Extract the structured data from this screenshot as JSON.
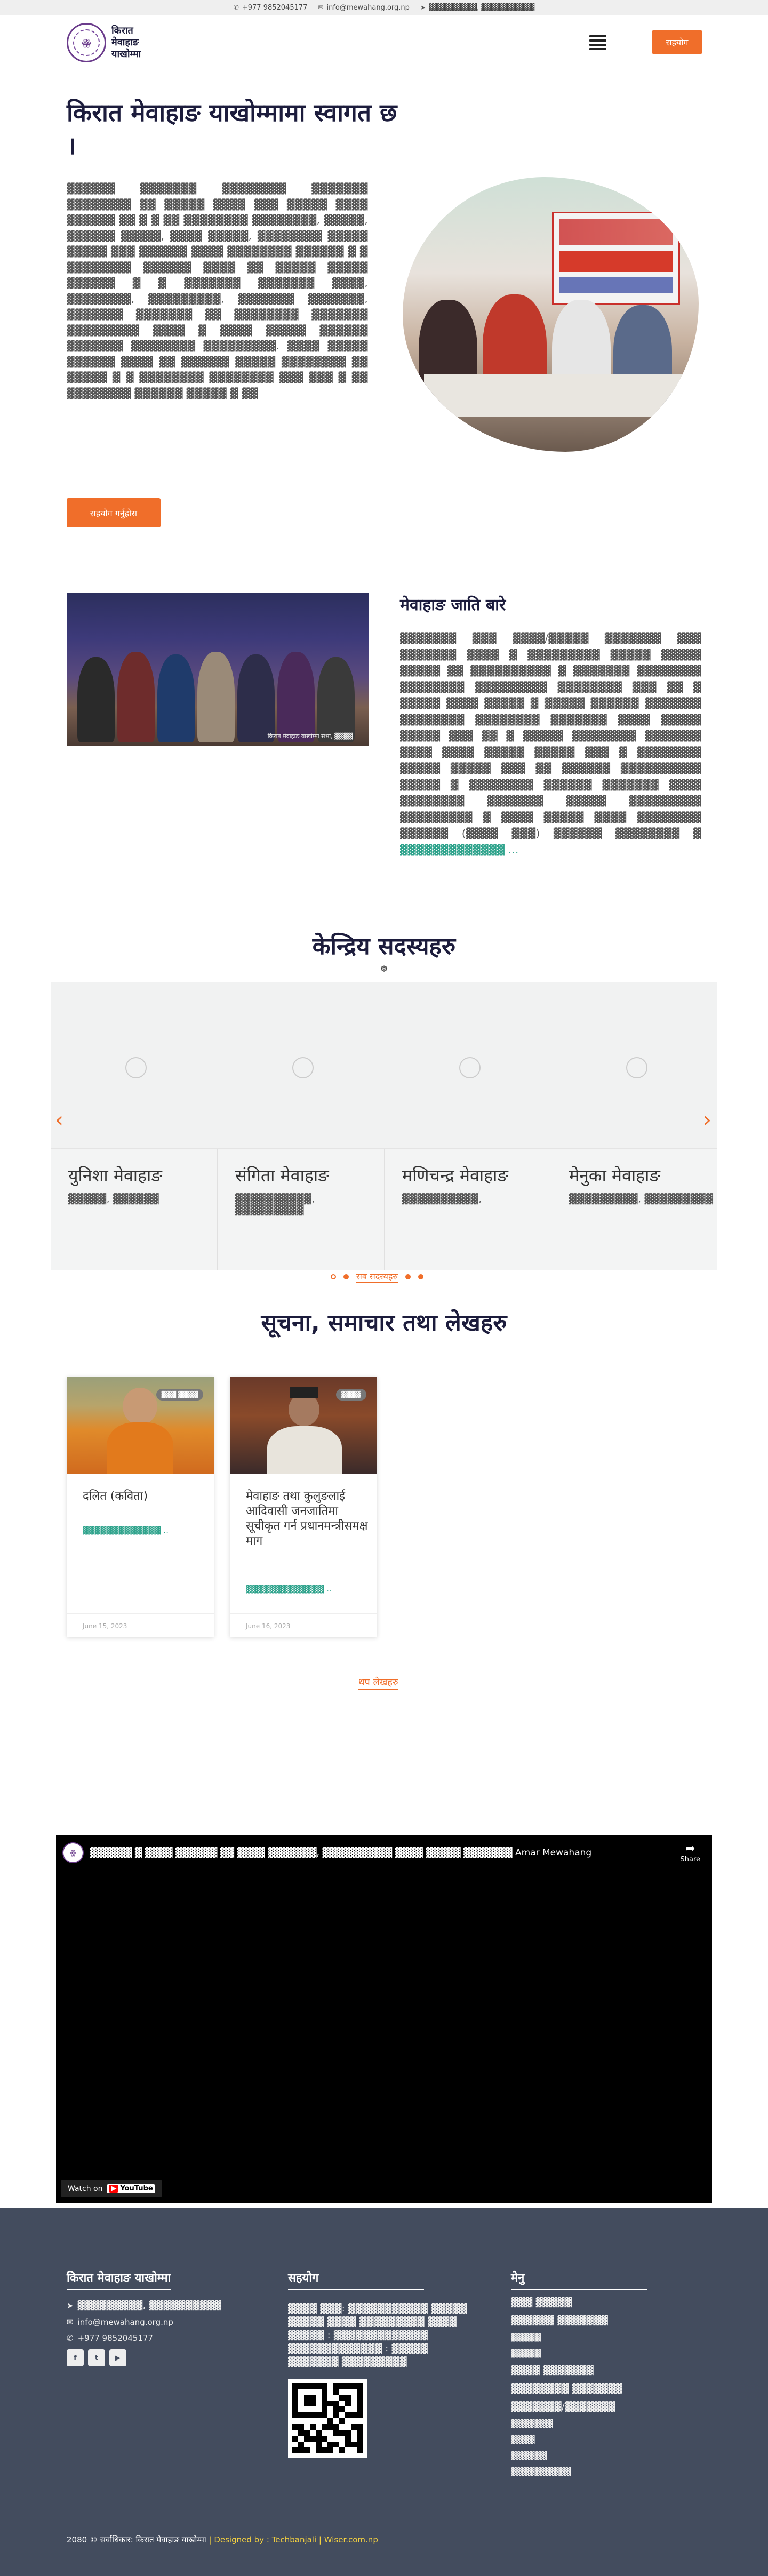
{
  "topbar": {
    "phone": "+977 9852045177",
    "email": "info@mewahang.org.np",
    "address": "▓▓▓▓▓▓▓▓▓, ▓▓▓▓▓▓▓▓▓▓"
  },
  "header": {
    "logo_text": "किरात\nमेवाहाङ\nयाखोम्मा",
    "logo_mark": "ꙮ",
    "support_button": "सहयोग"
  },
  "hero": {
    "title": "किरात मेवाहाङ याखोम्मामा स्वागत छ ।",
    "body": "▓▓▓▓▓▓ ▓▓▓▓▓▓▓ ▓▓▓▓▓▓▓▓ ▓▓▓▓▓▓▓ ▓▓▓▓▓▓▓▓ ▓▓ ▓▓▓▓▓ ▓▓▓▓ ▓▓▓ ▓▓▓▓▓ ▓▓▓▓ ▓▓▓▓▓▓ ▓▓ ▓ ▓ ▓▓ ▓▓▓▓▓▓▓▓ ▓▓▓▓▓▓▓▓, ▓▓▓▓▓, ▓▓▓▓▓▓ ▓▓▓▓▓, ▓▓▓▓ ▓▓▓▓▓, ▓▓▓▓▓▓▓▓ ▓▓▓▓▓ ▓▓▓▓▓ ▓▓▓ ▓▓▓▓▓▓ ▓▓▓▓ ▓▓▓▓▓▓▓▓ ▓▓▓▓▓▓ ▓ ▓ ▓▓▓▓▓▓▓▓ ▓▓▓▓▓▓ ▓▓▓▓ ▓▓ ▓▓▓▓▓ ▓▓▓▓▓ ▓▓▓▓▓▓ ▓ ▓ ▓▓▓▓▓▓▓ ▓▓▓▓▓▓▓ ▓▓▓▓, ▓▓▓▓▓▓▓▓, ▓▓▓▓▓▓▓▓▓, ▓▓▓▓▓▓▓ ▓▓▓▓▓▓▓, ▓▓▓▓▓▓▓ ▓▓▓▓▓▓▓ ▓▓ ▓▓▓▓▓▓▓▓ ▓▓▓▓▓▓▓ ▓▓▓▓▓▓▓▓▓ ▓▓▓▓ ▓ ▓▓▓▓ ▓▓▓▓▓ ▓▓▓▓▓▓ ▓▓▓▓▓▓▓ ▓▓▓▓▓▓▓▓ ▓▓▓▓▓▓▓▓▓. ▓▓▓▓ ▓▓▓▓▓ ▓▓▓▓▓▓ ▓▓▓▓ ▓▓ ▓▓▓▓▓▓ ▓▓▓▓▓ ▓▓▓▓▓▓▓▓ ▓▓ ▓▓▓▓▓ ▓ ▓ ▓▓▓▓▓▓▓▓ ▓▓▓▓▓▓▓▓ ▓▓▓ ▓▓▓ ▓ ▓▓ ▓▓▓▓▓▓▓▓ ▓▓▓▓▓▓ ▓▓▓▓▓ ▓ ▓▓",
    "button": "सहयोग गर्नुहोस"
  },
  "about": {
    "image_caption": "किरात मेवाहाङ याखोम्मा सभा, ▓▓▓▓",
    "title": "मेवाहाङ जाति बारे",
    "body": "▓▓▓▓▓▓▓ ▓▓▓ ▓▓▓▓/▓▓▓▓▓ ▓▓▓▓▓▓▓ ▓▓▓ ▓▓▓▓▓▓▓ ▓▓▓▓ ▓ ▓▓▓▓▓▓▓▓▓ ▓▓▓▓▓ ▓▓▓▓▓ ▓▓▓▓▓ ▓▓ ▓▓▓▓▓▓▓▓▓▓ ▓ ▓▓▓▓▓▓▓ ▓▓▓▓▓▓▓▓ ▓▓▓▓▓▓▓▓ ▓▓▓▓▓▓▓▓▓ ▓▓▓▓▓▓▓▓ ▓▓▓ ▓▓ ▓ ▓▓▓▓▓ ▓▓▓▓ ▓▓▓▓▓ ▓ ▓▓▓▓▓ ▓▓▓▓▓▓ ▓▓▓▓▓▓▓ ▓▓▓▓▓▓▓▓ ▓▓▓▓▓▓▓▓ ▓▓▓▓▓▓▓ ▓▓▓▓ ▓▓▓▓▓ ▓▓▓▓▓ ▓▓▓ ▓▓ ▓ ▓▓▓▓▓ ▓▓▓▓▓▓▓▓ ▓▓▓▓▓▓▓ ▓▓▓▓ ▓▓▓▓ ▓▓▓▓▓ ▓▓▓▓▓ ▓▓▓ ▓ ▓▓▓▓▓▓▓▓ ▓▓▓▓▓ ▓▓▓▓▓ ▓▓▓ ▓▓ ▓▓▓▓▓▓ ▓▓▓▓▓▓▓▓▓▓ ▓▓▓▓▓ ▓ ▓▓▓▓▓▓▓▓ ▓▓▓▓▓▓ ▓▓▓▓▓▓▓ ▓▓▓▓ ▓▓▓▓▓▓▓▓ ▓▓▓▓▓▓▓ ▓▓▓▓▓ ▓▓▓▓▓▓▓▓▓ ▓▓▓▓▓▓▓▓▓ ▓ ▓▓▓▓ ▓▓▓▓▓ ▓▓▓▓ ▓▓▓▓▓▓▓▓ ▓▓▓▓▓▓ (▓▓▓▓ ▓▓▓) ▓▓▓▓▓▓ ▓▓▓▓▓▓▓▓ ▓",
    "more_link": "▓▓▓▓▓▓▓▓▓▓▓▓▓ ..."
  },
  "members": {
    "title": "केन्द्रिय सदस्यहरु",
    "divider_icon": "☸",
    "prev": "‹",
    "next": "›",
    "cards": [
      {
        "name": "युनिशा मेवाहाङ",
        "role": "▓▓▓▓▓, ▓▓▓▓▓▓"
      },
      {
        "name": "संगिता मेवाहाङ",
        "role": "▓▓▓▓▓▓▓▓▓▓, ▓▓▓▓▓▓▓▓▓"
      },
      {
        "name": "मणिचन्द्र मेवाहाङ",
        "role": "▓▓▓▓▓▓▓▓▓▓,"
      },
      {
        "name": "मेनुका मेवाहाङ",
        "role": "▓▓▓▓▓▓▓▓▓, ▓▓▓▓▓▓▓▓▓"
      }
    ],
    "all_link": "सब सदस्यहरु"
  },
  "news": {
    "title": "सूचना, समाचार तथा लेखहरु",
    "posts": [
      {
        "tag": "▓▓▓ ▓▓▓▓",
        "title": "दलित (कविता)",
        "more": "▓▓▓▓▓▓▓▓▓▓▓▓▓ ..",
        "date": "June 15, 2023"
      },
      {
        "tag": "▓▓▓▓",
        "title": "मेवाहाङ तथा कुलुङलाई आदिवासी जनजातिमा सूचीकृत गर्न प्रधानमन्त्रीसमक्ष माग",
        "more": "▓▓▓▓▓▓▓▓▓▓▓▓▓ ..",
        "date": "June 16, 2023"
      }
    ],
    "more_posts": "थप लेखहरु"
  },
  "video": {
    "title": "▓▓▓▓▓▓ ▓ ▓▓▓▓ ▓▓▓▓▓▓ ▓▓ ▓▓▓▓ ▓▓▓▓▓▓▓, ▓▓▓▓▓▓▓▓▓▓ ▓▓▓▓ ▓▓▓▓▓ ▓▓▓▓▓▓▓ Amar Mewahang",
    "share": "Share",
    "watch_on": "Watch on",
    "youtube": "YouTube"
  },
  "footer": {
    "org_title": "किरात मेवाहाङ याखोम्मा",
    "address": "▓▓▓▓▓▓▓▓▓, ▓▓▓▓▓▓▓▓▓▓",
    "email": "info@mewahang.org.np",
    "phone": "+977 9852045177",
    "support_title": "सहयोग",
    "support_text": "▓▓▓▓ ▓▓▓: ▓▓▓▓▓▓▓▓▓▓▓ ▓▓▓▓▓ ▓▓▓▓▓ ▓▓▓▓ ▓▓▓▓▓▓▓▓▓ ▓▓▓▓ ▓▓▓▓▓ : ▓▓▓▓▓▓▓▓▓▓▓▓▓ ▓▓▓▓▓▓▓▓▓▓▓▓▓ : ▓▓▓▓▓ ▓▓▓▓▓▓▓ ▓▓▓▓▓▓▓▓▓",
    "menu_title": "मेनु",
    "menu": [
      {
        "label": "▓▓▓ ▓▓▓▓▓",
        "big": true
      },
      {
        "label": "▓▓▓▓▓▓ ▓▓▓▓▓▓▓",
        "big": true
      },
      {
        "label": "▓▓▓▓▓",
        "big": false
      },
      {
        "label": "▓▓▓▓▓",
        "big": false
      },
      {
        "label": "▓▓▓▓ ▓▓▓▓▓▓▓",
        "big": true
      },
      {
        "label": "▓▓▓▓▓▓▓▓ ▓▓▓▓▓▓▓",
        "big": true
      },
      {
        "label": "▓▓▓▓▓▓▓/▓▓▓▓▓▓▓",
        "big": true
      },
      {
        "label": "▓▓▓▓▓▓▓",
        "big": false
      },
      {
        "label": "▓▓▓▓",
        "big": false
      },
      {
        "label": "▓▓▓▓▓▓",
        "big": false
      },
      {
        "label": "▓▓▓▓▓▓▓▓▓▓",
        "big": false
      }
    ],
    "copyright": "2080 © सर्वाधिकार: किरात मेवाहाङ याखोम्मा",
    "designed_by": " | Designed by : Techbanjali | Wiser.com.np"
  },
  "colors": {
    "accent": "#f06e2a",
    "footer_bg": "#434c5e",
    "link_green": "#2fa38c",
    "heading": "#1c1c3c"
  }
}
